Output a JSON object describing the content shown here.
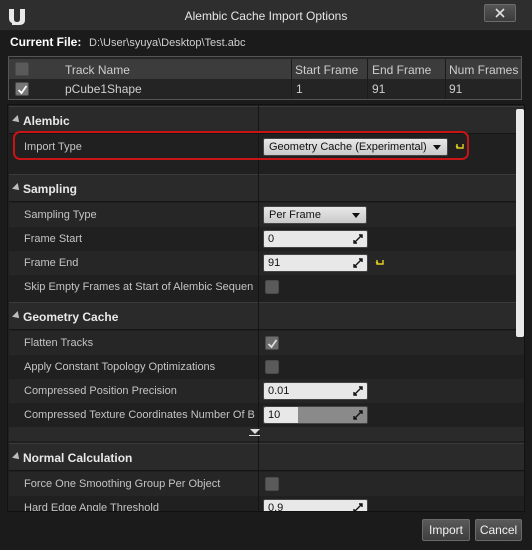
{
  "window": {
    "title": "Alembic Cache Import Options",
    "logo": "unreal-logo",
    "close_icon": "close-icon"
  },
  "current_file": {
    "label": "Current File:",
    "path": "D:\\User\\syuya\\Desktop\\Test.abc"
  },
  "tracks": {
    "headers": [
      "Track Name",
      "Start Frame",
      "End Frame",
      "Num Frames"
    ],
    "rows": [
      {
        "checked": true,
        "name": "pCube1Shape",
        "start": "1",
        "end": "91",
        "num": "91"
      }
    ]
  },
  "sections": {
    "alembic": "Alembic",
    "sampling": "Sampling",
    "geometry_cache": "Geometry Cache",
    "normal_calculation": "Normal Calculation"
  },
  "alembic": {
    "import_type_label": "Import Type",
    "import_type_value": "Geometry Cache (Experimental)"
  },
  "sampling": {
    "sampling_type_label": "Sampling Type",
    "sampling_type_value": "Per Frame",
    "frame_start_label": "Frame Start",
    "frame_start_value": "0",
    "frame_end_label": "Frame End",
    "frame_end_value": "91",
    "skip_empty_label": "Skip Empty Frames at Start of Alembic Sequen",
    "skip_empty_checked": false
  },
  "geometry_cache": {
    "flatten_tracks_label": "Flatten Tracks",
    "flatten_tracks_checked": true,
    "constant_topology_label": "Apply Constant Topology Optimizations",
    "constant_topology_checked": false,
    "position_precision_label": "Compressed Position Precision",
    "position_precision_value": "0.01",
    "texcoord_bits_label": "Compressed Texture Coordinates Number Of B",
    "texcoord_bits_value": "10",
    "texcoord_bits_fraction": 0.33
  },
  "normal_calculation": {
    "smoothing_group_label": "Force One Smoothing Group Per Object",
    "smoothing_group_checked": false,
    "hard_edge_label": "Hard Edge Angle Threshold",
    "hard_edge_value": "0.9"
  },
  "buttons": {
    "import": "Import",
    "cancel": "Cancel"
  },
  "colors": {
    "highlight": "#c81414",
    "reset_arrow": "#e8d020",
    "background": "#1b1b1b"
  }
}
